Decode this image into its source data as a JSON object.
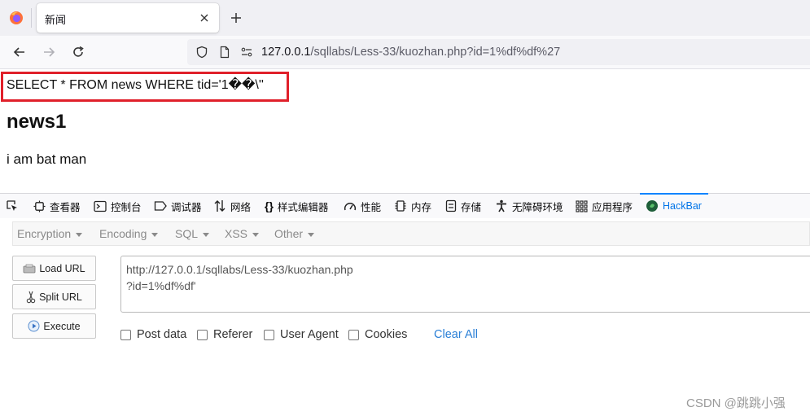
{
  "browser": {
    "tab_title": "新闻",
    "url_host": "127.0.0.1",
    "url_path": "/sqllabs/Less-33/kuozhan.php?id=1%df%df%27"
  },
  "page": {
    "sql_query": "SELECT * FROM news WHERE tid='1��\\''",
    "news_title": "news1",
    "news_body": "i am bat man"
  },
  "devtools": {
    "items": [
      {
        "label": "查看器",
        "icon": "inspector-icon"
      },
      {
        "label": "控制台",
        "icon": "console-icon"
      },
      {
        "label": "调试器",
        "icon": "debugger-icon"
      },
      {
        "label": "网络",
        "icon": "network-icon"
      },
      {
        "label": "样式编辑器",
        "icon": "style-editor-icon"
      },
      {
        "label": "性能",
        "icon": "performance-icon"
      },
      {
        "label": "内存",
        "icon": "memory-icon"
      },
      {
        "label": "存储",
        "icon": "storage-icon"
      },
      {
        "label": "无障碍环境",
        "icon": "accessibility-icon"
      },
      {
        "label": "应用程序",
        "icon": "application-icon"
      },
      {
        "label": "HackBar",
        "icon": "hackbar-icon"
      }
    ],
    "active_tab": "HackBar"
  },
  "hackbar": {
    "menu": [
      "Encryption",
      "Encoding",
      "SQL",
      "XSS",
      "Other"
    ],
    "buttons": {
      "load_url": "Load URL",
      "split_url": "Split URL",
      "execute": "Execute"
    },
    "url_value": "http://127.0.0.1/sqllabs/Less-33/kuozhan.php\n?id=1%df%df'",
    "options": [
      "Post data",
      "Referer",
      "User Agent",
      "Cookies"
    ],
    "clear_all": "Clear All"
  },
  "watermark": "CSDN @跳跳小强",
  "colors": {
    "highlight_box": "#e0202a",
    "accent": "#0a84ff",
    "link": "#2a7fd6"
  }
}
